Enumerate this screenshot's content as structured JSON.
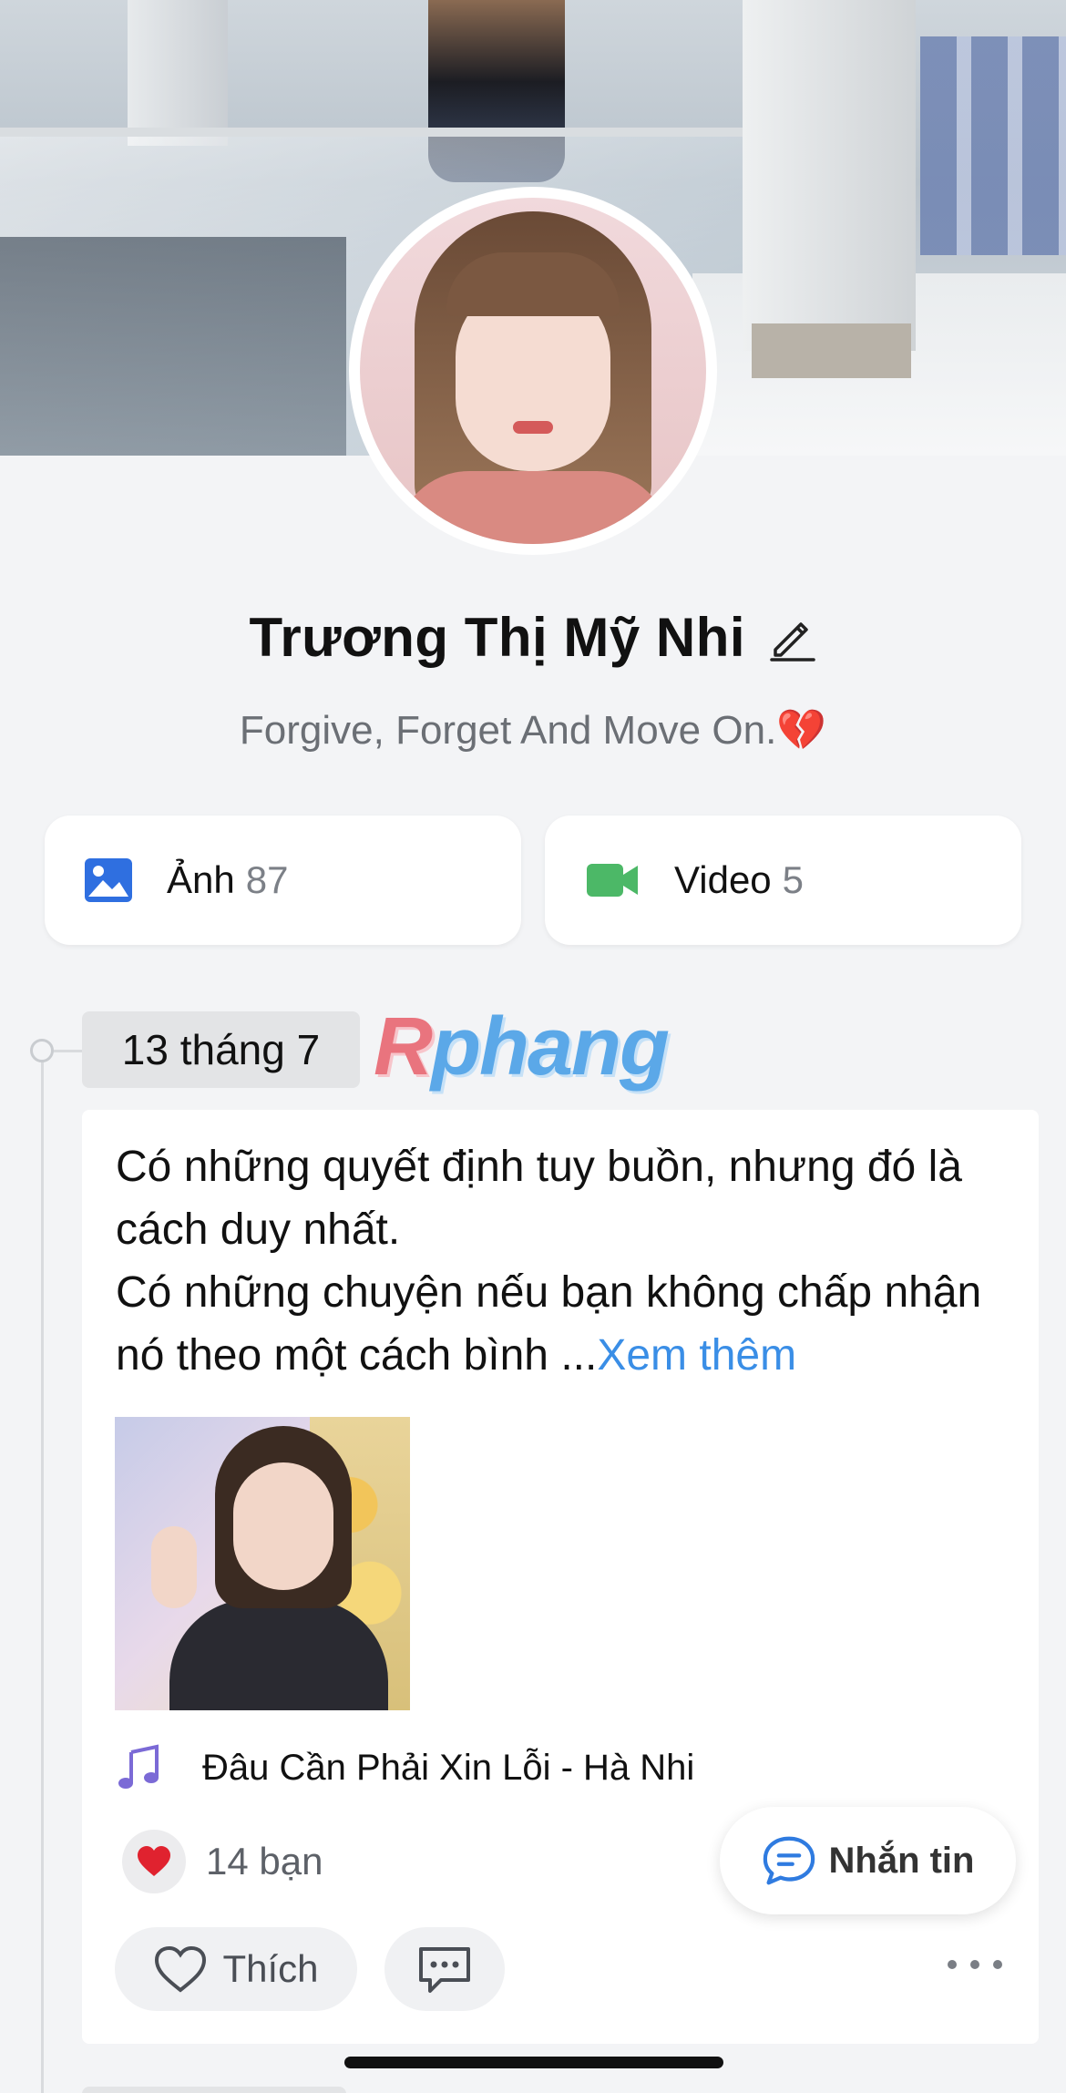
{
  "profile": {
    "name": "Trương Thị Mỹ Nhi",
    "bio": "Forgive, Forget And Move On.💔"
  },
  "media": {
    "photos_label": "Ảnh",
    "photos_count": "87",
    "videos_label": "Video",
    "videos_count": "5"
  },
  "timeline": {
    "date": "13 tháng 7",
    "watermark": "Rphang"
  },
  "post": {
    "text_line1": "Có những quyết định tuy buồn, nhưng đó là cách duy nhất.",
    "text_line2": "Có những chuyện nếu bạn không chấp nhận nó theo một cách bình ...",
    "see_more": "Xem thêm",
    "music": "Đâu Cần Phải Xin Lỗi - Hà Nhi",
    "reaction_count": "14 bạn",
    "like_label": "Thích"
  },
  "fab": {
    "message_label": "Nhắn tin"
  },
  "colors": {
    "accent": "#3a8ee6",
    "photo_icon": "#2f6fe0",
    "video_icon": "#4cb867",
    "music_icon": "#7b6ad6",
    "heart": "#e0222f"
  },
  "icons": {
    "edit": "pencil-icon",
    "photos": "image-icon",
    "videos": "video-camera-icon",
    "music": "music-note-icon",
    "reaction": "heart-icon",
    "like": "heart-outline-icon",
    "comment": "comment-icon",
    "more": "more-dots-icon",
    "message": "chat-bubble-icon"
  }
}
